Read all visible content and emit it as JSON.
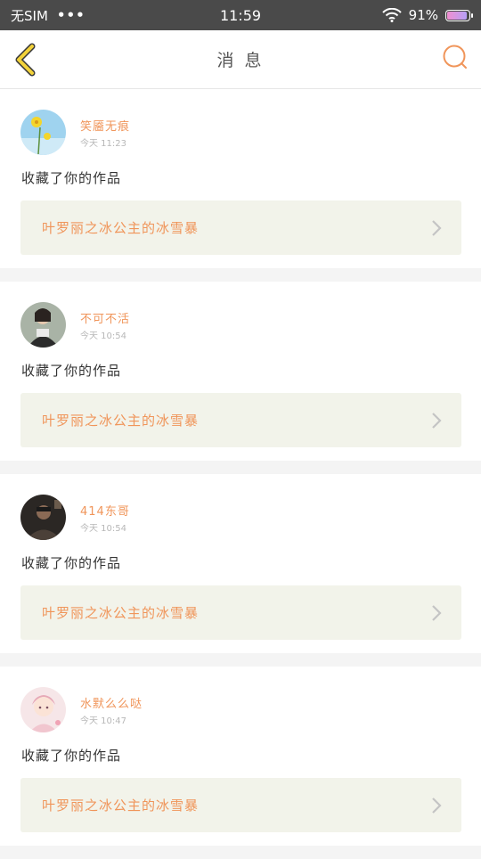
{
  "status_bar": {
    "carrier": "无SIM",
    "dots": "•••",
    "time": "11:59",
    "battery": "91%",
    "battery_level": 0.91
  },
  "header": {
    "title": "消 息"
  },
  "colors": {
    "accent": "#f0955a",
    "back_arrow": "#f2d23a",
    "card_bg": "#f2f3ea"
  },
  "notifications": [
    {
      "user": "笑靥无痕",
      "time": "今天 11:23",
      "action": "收藏了你的作品",
      "work_title": "叶罗丽之冰公主的冰雪暴"
    },
    {
      "user": "不可不活",
      "time": "今天 10:54",
      "action": "收藏了你的作品",
      "work_title": "叶罗丽之冰公主的冰雪暴"
    },
    {
      "user": "414东哥",
      "time": "今天 10:54",
      "action": "收藏了你的作品",
      "work_title": "叶罗丽之冰公主的冰雪暴"
    },
    {
      "user": "水默么么哒",
      "time": "今天 10:47",
      "action": "收藏了你的作品",
      "work_title": "叶罗丽之冰公主的冰雪暴"
    }
  ]
}
